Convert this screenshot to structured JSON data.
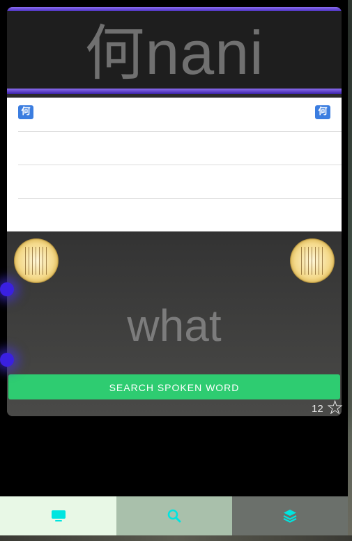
{
  "card": {
    "kanji": "何",
    "romaji": "nani",
    "list_badges": {
      "left": "何",
      "right": "何"
    },
    "meaning": "what",
    "search_label": "SEARCH SPOKEN WORD",
    "count": "12",
    "star_icon": "star-outline-icon"
  },
  "nav": {
    "tabs": [
      {
        "name": "tab-cards",
        "icon": "monitor-icon",
        "bg": "#e8f8e6",
        "active": true
      },
      {
        "name": "tab-search",
        "icon": "search-icon",
        "bg": "#a9c0ab",
        "active": false
      },
      {
        "name": "tab-decks",
        "icon": "layers-icon",
        "bg": "#6b706b",
        "active": false
      }
    ],
    "icon_color": "#00e5e0"
  },
  "colors": {
    "accent_purple": "#6a4fe0",
    "button_green": "#2ecc71",
    "badge_blue": "#3b7de0"
  }
}
